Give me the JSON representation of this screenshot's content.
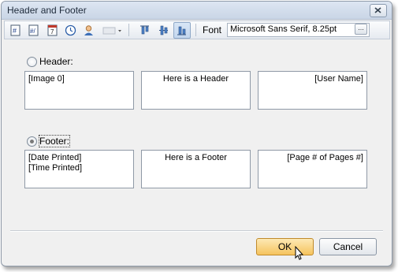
{
  "window": {
    "title": "Header and Footer"
  },
  "toolbar": {
    "buttons": [
      {
        "icon": "page-number-icon"
      },
      {
        "icon": "page-of-pages-icon"
      },
      {
        "icon": "date-icon"
      },
      {
        "icon": "time-icon"
      },
      {
        "icon": "user-name-icon"
      },
      {
        "icon": "image-dropdown-icon"
      },
      {
        "icon": "align-top-icon"
      },
      {
        "icon": "align-center-icon"
      },
      {
        "icon": "align-bottom-icon"
      }
    ],
    "font_label": "Font",
    "font_value": "Microsoft Sans Serif, 8.25pt",
    "font_browse_label": "..."
  },
  "header": {
    "label": "Header:",
    "selected": false,
    "left": "[Image 0]",
    "center": "Here is a Header",
    "right": "[User Name]"
  },
  "footer": {
    "label": "Footer:",
    "selected": true,
    "left_line1": "[Date Printed]",
    "left_line2": "[Time Printed]",
    "center": "Here is a Footer",
    "right": "[Page # of Pages #]"
  },
  "actions": {
    "ok_label": "OK",
    "cancel_label": "Cancel"
  },
  "colors": {
    "ok_button": "#f5c35e",
    "pressed_toolbar_button": "#c4d7ee"
  }
}
